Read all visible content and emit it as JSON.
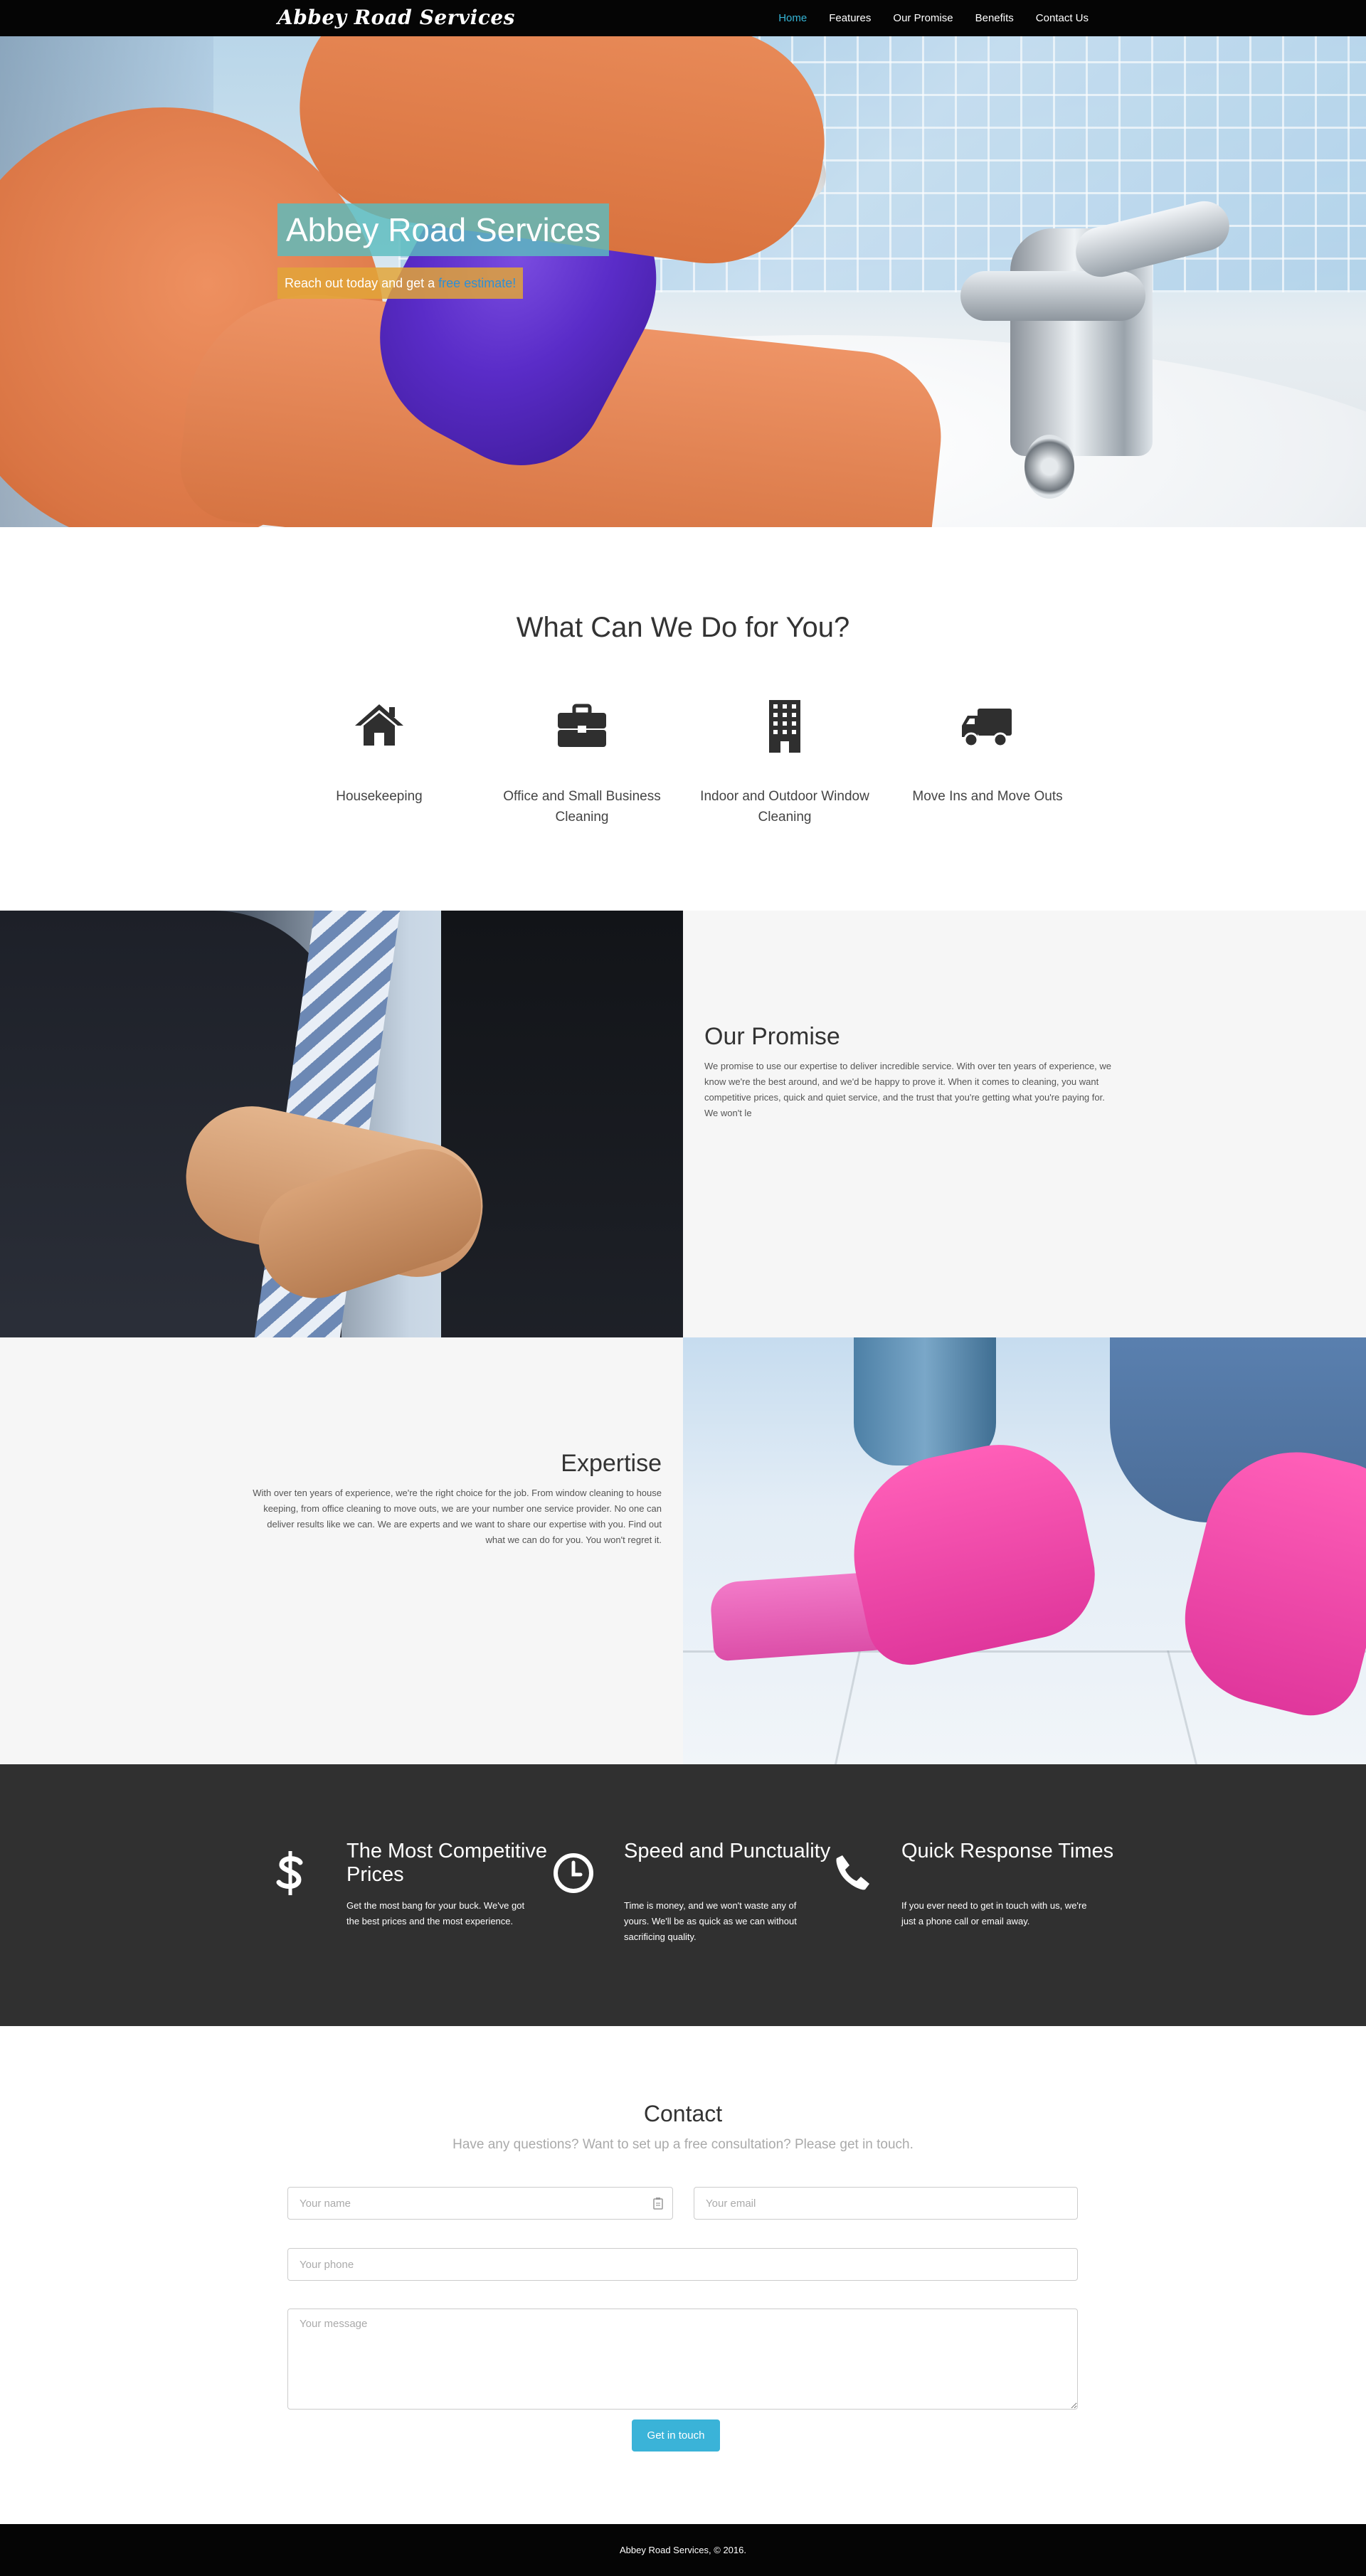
{
  "navbar": {
    "brand": "Abbey Road Services",
    "links": [
      "Home",
      "Features",
      "Our Promise",
      "Benefits",
      "Contact Us"
    ],
    "active_link": "Home"
  },
  "hero": {
    "title": "Abbey Road Services",
    "subtitle_prefix": "Reach out today and get a ",
    "subtitle_link": "free estimate!"
  },
  "services": {
    "title": "What Can We Do for You?",
    "items": [
      {
        "label": "Housekeeping",
        "icon": "house-icon"
      },
      {
        "label": "Office and Small Business Cleaning",
        "icon": "briefcase-icon"
      },
      {
        "label": "Indoor and Outdoor Window Cleaning",
        "icon": "building-icon"
      },
      {
        "label": "Move Ins and Move Outs",
        "icon": "truck-icon"
      }
    ]
  },
  "promise": {
    "title": "Our Promise",
    "text": "We promise to use our expertise to deliver incredible service. With over ten years of experience, we know we're the best around, and we'd be happy to prove it. When it comes to cleaning, you want competitive prices, quick and quiet service, and the trust that you're getting what you're paying for. We won't le"
  },
  "expertise": {
    "title": "Expertise",
    "text": "With over ten years of experience, we're the right choice for the job. From window cleaning to house keeping, from office cleaning to move outs, we are your number one service provider. No one can deliver results like we can. We are experts and we want to share our expertise with you. Find out what we can do for you. You won't regret it."
  },
  "features": [
    {
      "icon": "dollar-icon",
      "title": "The Most Competitive Prices",
      "text": "Get the most bang for your buck. We've got the best prices and the most experience."
    },
    {
      "icon": "clock-icon",
      "title": "Speed and Punctuality",
      "text": "Time is money, and we won't waste any of yours. We'll be as quick as we can without sacrificing quality."
    },
    {
      "icon": "phone-icon",
      "title": "Quick Response Times",
      "text": "If you ever need to get in touch with us, we're just a phone call or email away."
    }
  ],
  "contact": {
    "title": "Contact",
    "subtitle": "Have any questions? Want to set up a free consultation? Please get in touch.",
    "name_placeholder": "Your name",
    "email_placeholder": "Your email",
    "phone_placeholder": "Your phone",
    "message_placeholder": "Your message",
    "submit_label": "Get in touch"
  },
  "footer": {
    "text": "Abbey Road Services, © 2016."
  },
  "colors": {
    "accent": "#35b5d6",
    "hero_title_bg": "#5cbcbe",
    "hero_sub_bg": "#e2a438",
    "dark_band": "#303030"
  }
}
